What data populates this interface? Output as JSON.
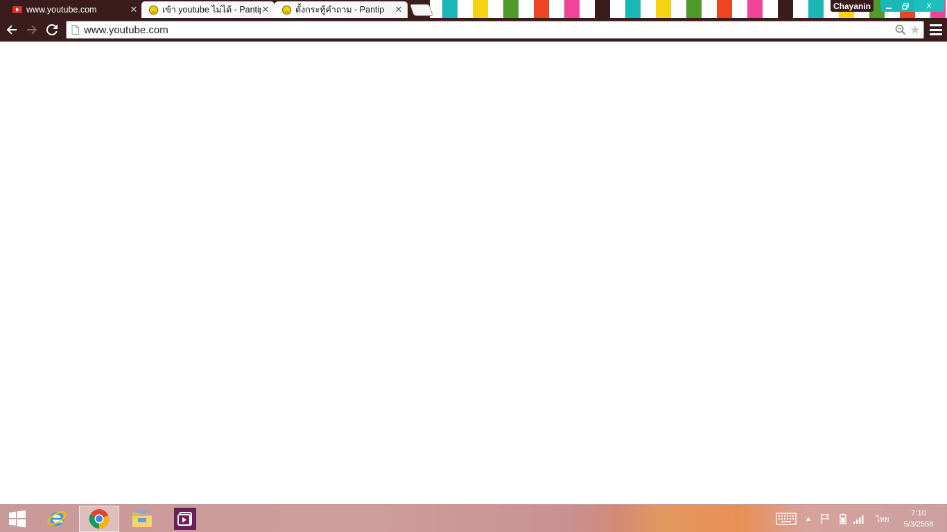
{
  "browser": {
    "tabs": [
      {
        "label": "www.youtube.com",
        "icon": "youtube-icon",
        "active": true
      },
      {
        "label": "เข้า youtube ไม่ได้ - Pantip",
        "icon": "pantip-icon",
        "active": false
      },
      {
        "label": "ตั้งกระทู้คำถาม - Pantip",
        "icon": "pantip-icon",
        "active": false
      }
    ],
    "profile_name": "Chayanin",
    "window_controls": {
      "minimize_icon": "minimize-icon",
      "maximize_icon": "restore-icon",
      "close_label": "X"
    },
    "theme_colors": [
      "#ffffff",
      "#f0449a",
      "#3a1c1c",
      "#1bb7b7",
      "#f7d316",
      "#4f9a2a",
      "#ee4423"
    ]
  },
  "toolbar": {
    "back_icon": "back-arrow-icon",
    "forward_icon": "forward-arrow-icon",
    "reload_icon": "reload-icon",
    "url": "www.youtube.com",
    "menu_icon": "hamburger-menu-icon"
  },
  "taskbar": {
    "pinned": [
      "start-icon",
      "internet-explorer-icon",
      "chrome-icon",
      "file-explorer-icon",
      "media-player-icon"
    ],
    "tray": {
      "language": "ไทย",
      "time": "7:10",
      "date": "5/3/2558"
    }
  }
}
